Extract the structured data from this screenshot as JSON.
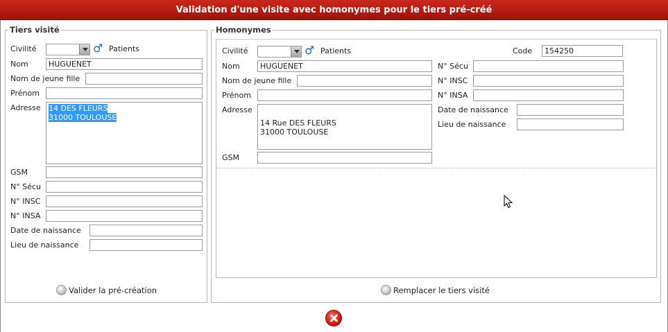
{
  "dialog": {
    "title": "Validation d'une visite avec homonymes pour le tiers pré-créé"
  },
  "left": {
    "legend": "Tiers visité",
    "civilite_label": "Civilité",
    "civilite_value": "",
    "patients_label": "Patients",
    "nom_label": "Nom",
    "nom_value": "HUGUENET",
    "jeune_fille_label": "Nom de jeune fille",
    "jeune_fille_value": "",
    "prenom_label": "Prénom",
    "prenom_value": "",
    "adresse_label": "Adresse",
    "adresse_line1": "14  DES FLEURS",
    "adresse_line2": "31000 TOULOUSE",
    "gsm_label": "GSM",
    "gsm_value": "",
    "secu_label": "N° Sécu",
    "secu_value": "",
    "insc_label": "N° INSC",
    "insc_value": "",
    "insa_label": "N° INSA",
    "insa_value": "",
    "naissance_label": "Date de naissance",
    "naissance_value": "",
    "lieu_label": "Lieu de naissance",
    "lieu_value": "",
    "validate_button": "Valider la pré-création"
  },
  "right": {
    "legend": "Homonymes",
    "civilite_label": "Civilité",
    "civilite_value": "",
    "patients_label": "Patients",
    "code_label": "Code",
    "code_value": "154250",
    "nom_label": "Nom",
    "nom_value": "HUGUENET",
    "jeune_fille_label": "Nom de jeune fille",
    "jeune_fille_value": "",
    "prenom_label": "Prénom",
    "prenom_value": "",
    "adresse_label": "Adresse",
    "adresse_line1": "14 Rue DES FLEURS",
    "adresse_line2": "31000 TOULOUSE",
    "gsm_label": "GSM",
    "gsm_value": "",
    "secu_label": "N° Sécu",
    "secu_value": "",
    "insc_label": "N° INSC",
    "insc_value": "",
    "insa_label": "N° INSA",
    "insa_value": "",
    "naissance_label": "Date de naissance",
    "naissance_value": "",
    "lieu_label": "Lieu de naissance",
    "lieu_value": "",
    "replace_button": "Remplacer le tiers visité"
  },
  "icons": {
    "male": "male-gender-icon",
    "close": "close-icon",
    "button_ball": "radio-ball-icon"
  },
  "colors": {
    "title_bar": "#b81c10",
    "selection": "#3399ff",
    "male_icon": "#1c6ab8"
  }
}
